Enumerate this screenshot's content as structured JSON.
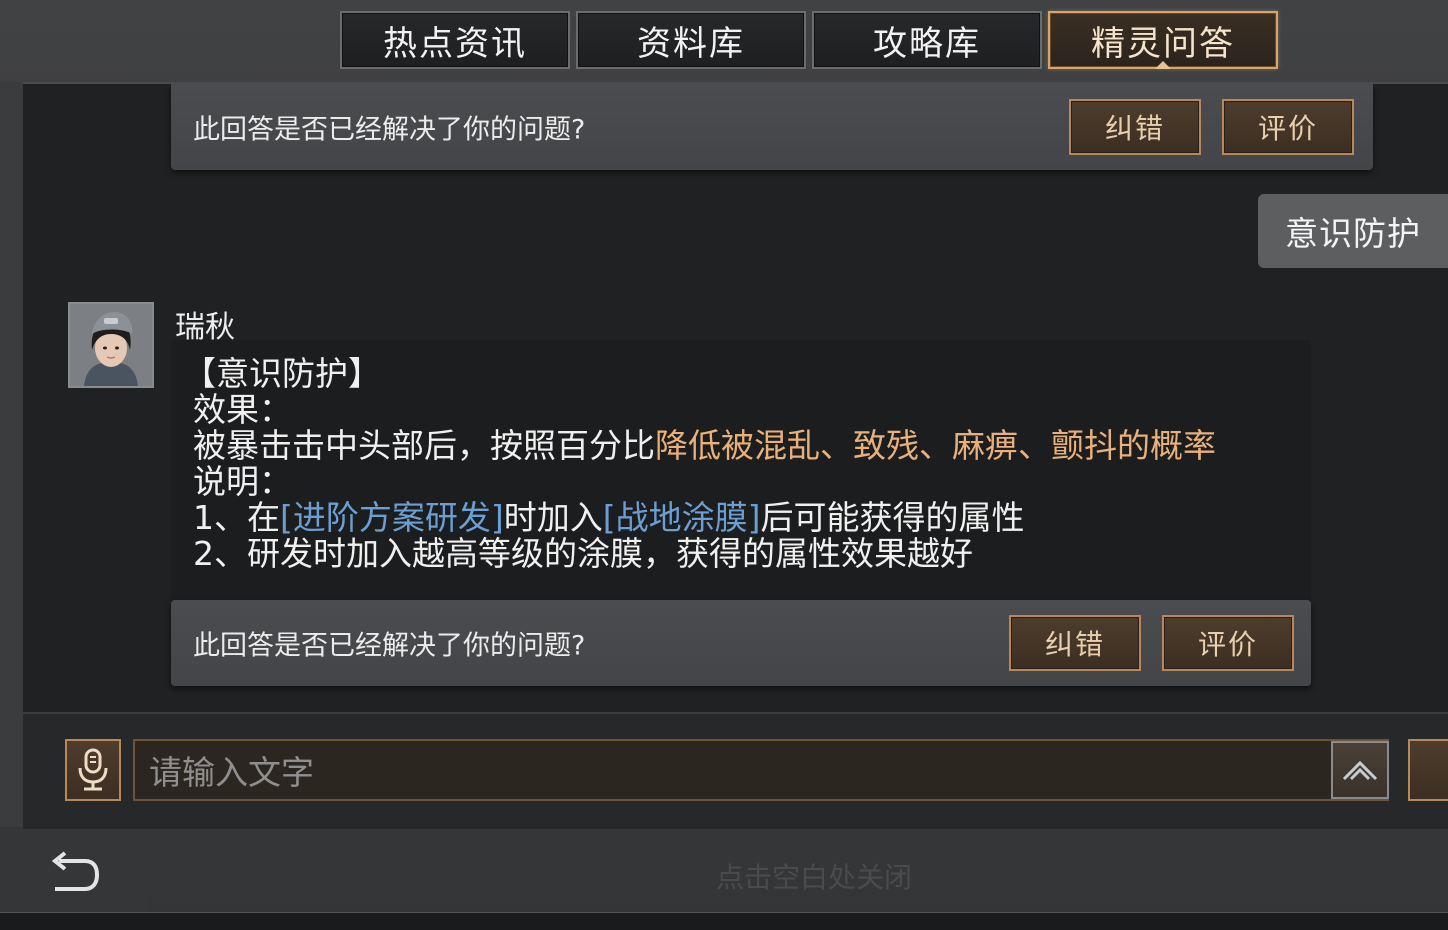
{
  "tabs": [
    {
      "label": "热点资讯",
      "active": false
    },
    {
      "label": "资料库",
      "active": false
    },
    {
      "label": "攻略库",
      "active": false
    },
    {
      "label": "精灵问答",
      "active": true
    }
  ],
  "feedback": {
    "question": "此回答是否已经解决了你的问题?",
    "correct_label": "纠错",
    "rate_label": "评价"
  },
  "user_message": "意识防护",
  "bot": {
    "name": "瑞秋",
    "answer": {
      "title": "【意识防护】",
      "effect_label": "效果：",
      "effect_prefix": "被暴击击中头部后，按照百分比",
      "effect_highlight": "降低被混乱、致残、麻痹、颤抖的概率",
      "desc_label": "说明：",
      "line1_prefix": "1、在",
      "line1_link1": "[进阶方案研发]",
      "line1_mid": "时加入",
      "line1_link2": "[战地涂膜]",
      "line1_suffix": "后可能获得的属性",
      "line2": "2、研发时加入越高等级的涂膜，获得的属性效果越好"
    }
  },
  "input": {
    "placeholder": "请输入文字"
  },
  "close_hint": "点击空白处关闭",
  "colors": {
    "accent_border": "#b8875a",
    "highlight_text": "#e8b07a",
    "link_text": "#6b9fd4"
  }
}
